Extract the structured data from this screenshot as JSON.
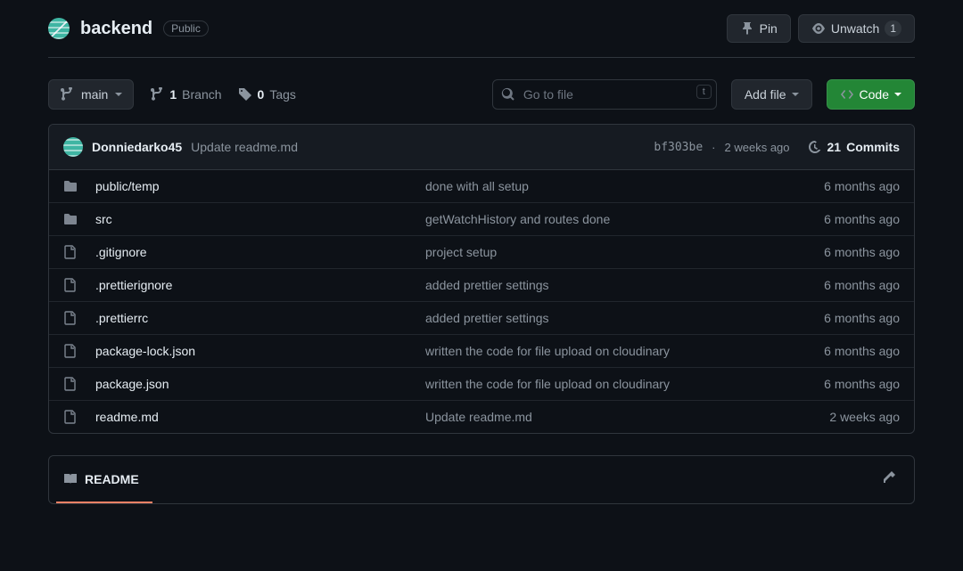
{
  "header": {
    "repo_name": "backend",
    "visibility": "Public",
    "pin_label": "Pin",
    "unwatch_label": "Unwatch",
    "unwatch_count": "1"
  },
  "toolbar": {
    "branch": "main",
    "branches_count": "1",
    "branches_label": "Branch",
    "tags_count": "0",
    "tags_label": "Tags",
    "search_placeholder": "Go to file",
    "search_kbd": "t",
    "add_file_label": "Add file",
    "code_label": "Code"
  },
  "commit": {
    "author": "Donniedarko45",
    "message": "Update readme.md",
    "hash": "bf303be",
    "time": "2 weeks ago",
    "commits_count": "21",
    "commits_label": "Commits"
  },
  "files": [
    {
      "type": "folder",
      "name": "public/temp",
      "message": "done with all setup",
      "time": "6 months ago"
    },
    {
      "type": "folder",
      "name": "src",
      "message": "getWatchHistory and routes done",
      "time": "6 months ago"
    },
    {
      "type": "file",
      "name": ".gitignore",
      "message": "project setup",
      "time": "6 months ago"
    },
    {
      "type": "file",
      "name": ".prettierignore",
      "message": "added prettier settings",
      "time": "6 months ago"
    },
    {
      "type": "file",
      "name": ".prettierrc",
      "message": "added prettier settings",
      "time": "6 months ago"
    },
    {
      "type": "file",
      "name": "package-lock.json",
      "message": "written the code for file upload on cloudinary",
      "time": "6 months ago"
    },
    {
      "type": "file",
      "name": "package.json",
      "message": "written the code for file upload on cloudinary",
      "time": "6 months ago"
    },
    {
      "type": "file",
      "name": "readme.md",
      "message": "Update readme.md",
      "time": "2 weeks ago"
    }
  ],
  "readme": {
    "tab_label": "README"
  }
}
